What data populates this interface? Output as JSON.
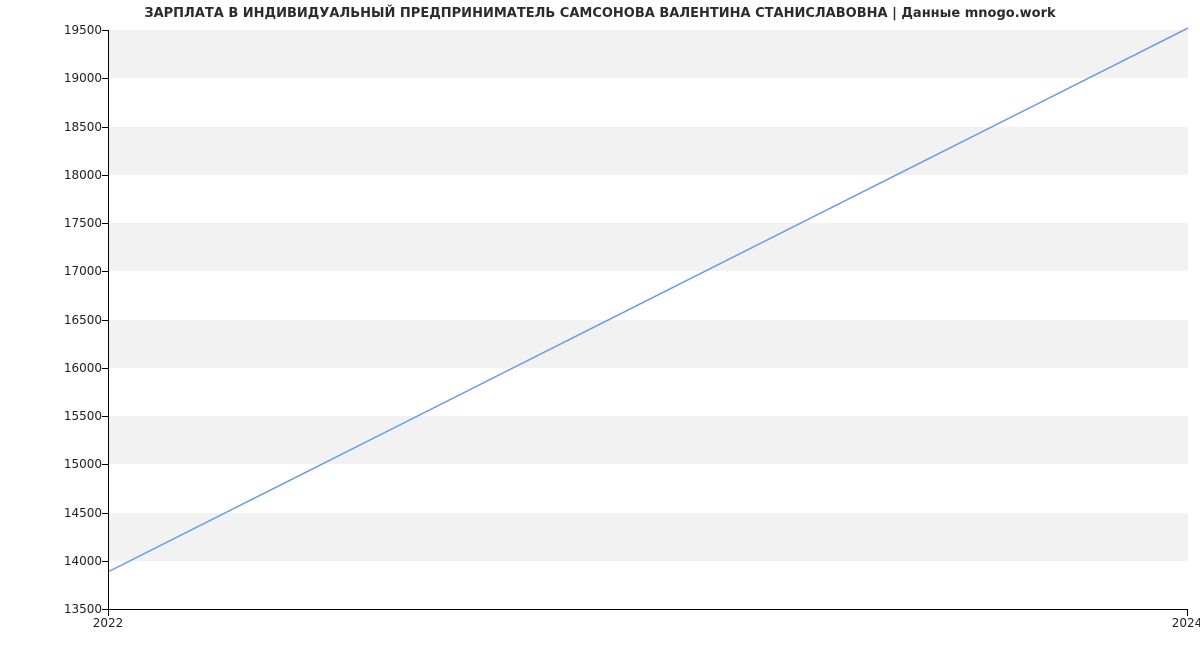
{
  "chart_data": {
    "type": "line",
    "title": "ЗАРПЛАТА В ИНДИВИДУАЛЬНЫЙ ПРЕДПРИНИМАТЕЛЬ САМСОНОВА ВАЛЕНТИНА СТАНИСЛАВОВНА | Данные mnogo.work",
    "xlabel": "",
    "ylabel": "",
    "x": [
      2022,
      2024
    ],
    "values": [
      13890,
      19520
    ],
    "xlim": [
      2022,
      2024
    ],
    "ylim": [
      13500,
      19500
    ],
    "yticks": [
      13500,
      14000,
      14500,
      15000,
      15500,
      16000,
      16500,
      17000,
      17500,
      18000,
      18500,
      19000,
      19500
    ],
    "xticks": [
      2022,
      2024
    ],
    "line_color": "#6b9be8",
    "grid_band_color": "#f2f2f2"
  }
}
